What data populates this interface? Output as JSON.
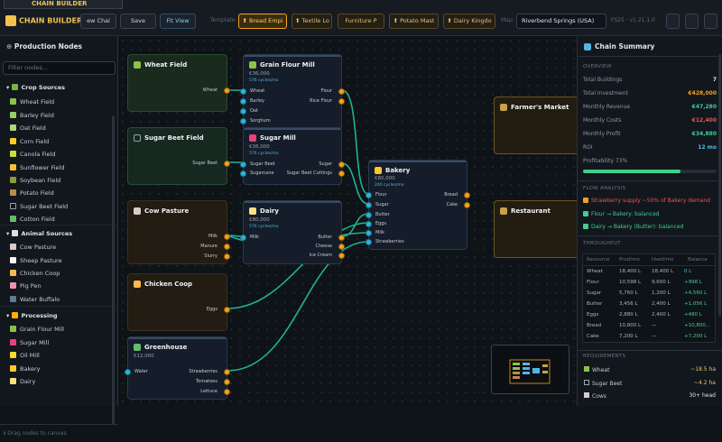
{
  "app": {
    "name": "CHAIN BUILDER",
    "logo_label": "CHAIN BUILDER"
  },
  "toolbar": {
    "new_label": "ew Chai",
    "save_label": "Save",
    "fit_label": "Fit View",
    "template_label": "Template:",
    "templates": [
      {
        "label": "⬆ Bread Empi",
        "active": true
      },
      {
        "label": "⬆ Textile Lo",
        "active": false
      },
      {
        "label": "Furniture P",
        "active": false
      },
      {
        "label": "⬆ Potato Mast",
        "active": false
      },
      {
        "label": "⬆ Dairy Kingdo",
        "active": false
      }
    ],
    "map_label": "Map:",
    "map_value": "Riverbend Springs (USA)",
    "version": "FS25 · v1.21.1.0"
  },
  "sidebar": {
    "title": "Production Nodes",
    "filter_placeholder": "Filter nodes...",
    "categories": [
      {
        "label": "Crop Sources",
        "items": [
          "Wheat Field",
          "Barley Field",
          "Oat Field",
          "Corn Field",
          "Canola Field",
          "Sunflower Field",
          "Soybean Field",
          "Potato Field",
          "Sugar Beet Field",
          "Cotton Field"
        ]
      },
      {
        "label": "Animal Sources",
        "items": [
          "Cow Pasture",
          "Sheep Pasture",
          "Chicken Coop",
          "Pig Pen",
          "Water Buffalo"
        ]
      },
      {
        "label": "Processing",
        "items": [
          "Grain Flour Mill",
          "Sugar Mill",
          "Oil Mill",
          "Bakery",
          "Dairy"
        ]
      }
    ],
    "footer": "Drag nodes to canvas"
  },
  "nodes": {
    "wheat_field": {
      "title": "Wheat Field",
      "out": "Wheat"
    },
    "sugar_beet_field": {
      "title": "Sugar Beet Field",
      "out": "Sugar Beet"
    },
    "cow_pasture": {
      "title": "Cow Pasture",
      "outs": [
        "Milk",
        "Manure",
        "Slurry"
      ]
    },
    "chicken_coop": {
      "title": "Chicken Coop",
      "out": "Eggs"
    },
    "greenhouse": {
      "title": "Greenhouse",
      "cost": "€12,000",
      "in": "Water",
      "outs": [
        "Strawberries",
        "Tomatoes",
        "Lettuce"
      ]
    },
    "grain_mill": {
      "title": "Grain Flour Mill",
      "cost": "€36,000",
      "rate": "576 cycles/mo",
      "ins": [
        "Wheat",
        "Barley",
        "Oat",
        "Sorghum"
      ],
      "outs": [
        "Flour",
        "Rice Flour"
      ]
    },
    "sugar_mill": {
      "title": "Sugar Mill",
      "cost": "€36,000",
      "rate": "576 cycles/mo",
      "ins": [
        "Sugar Beet",
        "Sugarcane"
      ],
      "outs": [
        "Sugar",
        "Sugar Beet Cuttings"
      ]
    },
    "dairy": {
      "title": "Dairy",
      "cost": "€80,000",
      "rate": "576 cycles/mo",
      "ins": [
        "Milk"
      ],
      "outs": [
        "Butter",
        "Cheese",
        "Ice Cream"
      ]
    },
    "bakery": {
      "title": "Bakery",
      "cost": "€80,000",
      "rate": "240 cycles/mo",
      "ins": [
        "Flour",
        "Sugar",
        "Butter",
        "Eggs",
        "Milk",
        "Strawberries"
      ],
      "outs": [
        "Bread",
        "Cake"
      ]
    },
    "farmers_market": {
      "title": "Farmer's Market"
    },
    "restaurant": {
      "title": "Restaurant"
    }
  },
  "summary": {
    "title": "Chain Summary",
    "overview_label": "OVERVIEW",
    "rows": [
      {
        "label": "Total Buildings",
        "value": "7",
        "color": "#dfe5ec"
      },
      {
        "label": "Total Investment",
        "value": "€428,000",
        "color": "#f2a31d"
      },
      {
        "label": "Monthly Revenue",
        "value": "€47,280",
        "color": "#3fcf8e"
      },
      {
        "label": "Monthly Costs",
        "value": "€12,400",
        "color": "#ef5350"
      },
      {
        "label": "Monthly Profit",
        "value": "€34,880",
        "color": "#3fcf8e"
      },
      {
        "label": "ROI",
        "value": "12 mo",
        "color": "#4fb7e6"
      }
    ],
    "profitability_label": "Profitability",
    "profitability_value": "73%",
    "profitability": 0.73,
    "flow_label": "FLOW ANALYSIS",
    "flows": [
      {
        "text": "Strawberry supply ~50% of Bakery demand",
        "color": "#ef5350",
        "icon": "warning-icon"
      },
      {
        "text": "Flour → Bakery: balanced",
        "color": "#3fcf8e",
        "icon": "check-icon"
      },
      {
        "text": "Dairy → Bakery (Butter): balanced",
        "color": "#3fcf8e",
        "icon": "check-icon"
      }
    ],
    "throughput_label": "THROUGHPUT",
    "table": {
      "headers": [
        "Resource",
        "Prod/mo",
        "Used/mo",
        "Balance"
      ],
      "rows": [
        [
          "Wheat",
          "18,400 L",
          "18,400 L",
          "0 L"
        ],
        [
          "Flour",
          "10,598 L",
          "9,600 L",
          "+998 L"
        ],
        [
          "Sugar",
          "5,760 L",
          "1,200 L",
          "+4,560 L"
        ],
        [
          "Butter",
          "3,456 L",
          "2,400 L",
          "+1,056 L"
        ],
        [
          "Eggs",
          "2,880 L",
          "2,400 L",
          "+480 L"
        ],
        [
          "Bread",
          "10,800 L",
          "—",
          "+10,800..."
        ],
        [
          "Cake",
          "7,200 L",
          "—",
          "+7,200 L"
        ]
      ]
    },
    "req_label": "REQUIREMENTS",
    "requirements": [
      {
        "label": "Wheat",
        "value": "~18.5 ha"
      },
      {
        "label": "Sugar Beet",
        "value": "~4.2 ha"
      },
      {
        "label": "Cows",
        "value": "30+ head"
      }
    ]
  }
}
